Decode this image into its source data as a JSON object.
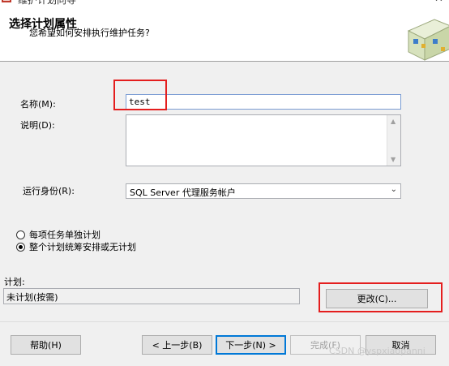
{
  "window": {
    "title": "维护计划向导",
    "close": "✕"
  },
  "header": {
    "title": "选择计划属性",
    "subtitle": "您希望如何安排执行维护任务?"
  },
  "form": {
    "name_label": "名称(M):",
    "name_value": "test",
    "desc_label": "说明(D):",
    "desc_value": "",
    "run_as_label": "运行身份(R):",
    "run_as_value": "SQL Server 代理服务帐户",
    "radio_separate": "每项任务单独计划",
    "radio_single": "整个计划统筹安排或无计划",
    "schedule_label": "计划:",
    "schedule_value": "未计划(按需)",
    "change_button": "更改(C)..."
  },
  "footer": {
    "help": "帮助(H)",
    "back": "< 上一步(B)",
    "next": "下一步(N) >",
    "finish": "完成(F)",
    "cancel": "取消"
  },
  "watermark": "CSDN @yspxiaopanni",
  "colors": {
    "highlight": "#e41e1e",
    "focus": "#0078d7"
  }
}
